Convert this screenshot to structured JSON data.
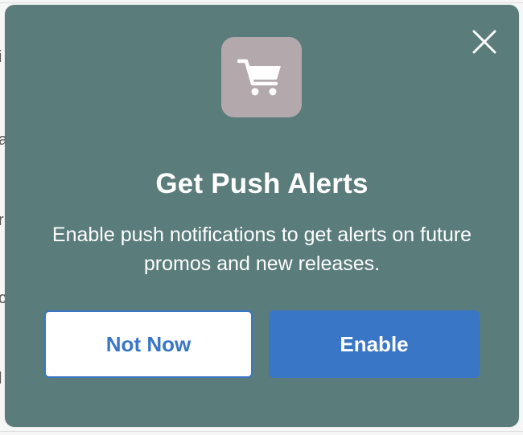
{
  "dialog": {
    "title": "Get Push Alerts",
    "description": "Enable push notifications to get alerts on future promos and new releases.",
    "icon": "shopping-cart-icon",
    "close_icon": "close-icon",
    "buttons": {
      "secondary_label": "Not Now",
      "primary_label": "Enable"
    }
  },
  "colors": {
    "modal_background": "#5a7c7b",
    "icon_tile": "#b3a9ad",
    "accent_blue": "#3a76c6",
    "text": "#ffffff"
  },
  "background": {
    "peeking_glyphs": [
      "i",
      "a",
      "r",
      "c",
      "l"
    ]
  }
}
